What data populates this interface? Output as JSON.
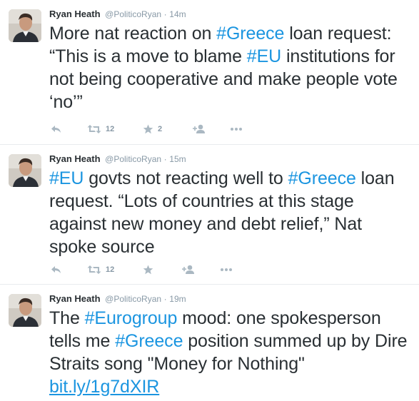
{
  "tweets": [
    {
      "name": "Ryan Heath",
      "handle": "@PoliticoRyan",
      "separator": "·",
      "time": "14m",
      "text_parts": [
        {
          "t": "More nat reaction on ",
          "k": "text"
        },
        {
          "t": "#Greece",
          "k": "hashtag"
        },
        {
          "t": " loan request: “This is a move to blame ",
          "k": "text"
        },
        {
          "t": "#EU",
          "k": "hashtag"
        },
        {
          "t": " institutions for not being cooperative and make people vote ‘no’”",
          "k": "text"
        }
      ],
      "retweet_count": "12",
      "favorite_count": "2"
    },
    {
      "name": "Ryan Heath",
      "handle": "@PoliticoRyan",
      "separator": "·",
      "time": "15m",
      "text_parts": [
        {
          "t": "#EU",
          "k": "hashtag"
        },
        {
          "t": " govts not reacting well to ",
          "k": "text"
        },
        {
          "t": "#Greece",
          "k": "hashtag"
        },
        {
          "t": " loan request. “Lots of countries at this stage against new money and debt relief,” Nat spoke source",
          "k": "text"
        }
      ],
      "retweet_count": "12",
      "favorite_count": ""
    },
    {
      "name": "Ryan Heath",
      "handle": "@PoliticoRyan",
      "separator": "·",
      "time": "19m",
      "text_parts": [
        {
          "t": "The ",
          "k": "text"
        },
        {
          "t": "#Eurogroup",
          "k": "hashtag"
        },
        {
          "t": " mood: one spokesperson tells me ",
          "k": "text"
        },
        {
          "t": "#Greece",
          "k": "hashtag"
        },
        {
          "t": " position summed up by Dire Straits song \"Money for Nothing\" ",
          "k": "text"
        },
        {
          "t": "bit.ly/1g7dXIR",
          "k": "link"
        }
      ],
      "retweet_count": "",
      "favorite_count": ""
    }
  ],
  "icons": {
    "reply": "reply-icon",
    "retweet": "retweet-icon",
    "favorite": "star-icon",
    "follow": "follow-icon",
    "more": "more-icon"
  },
  "colors": {
    "hashtag": "#1b95e0",
    "text": "#292f33",
    "meta": "#8899a6",
    "action_icon": "#aab8c2"
  }
}
